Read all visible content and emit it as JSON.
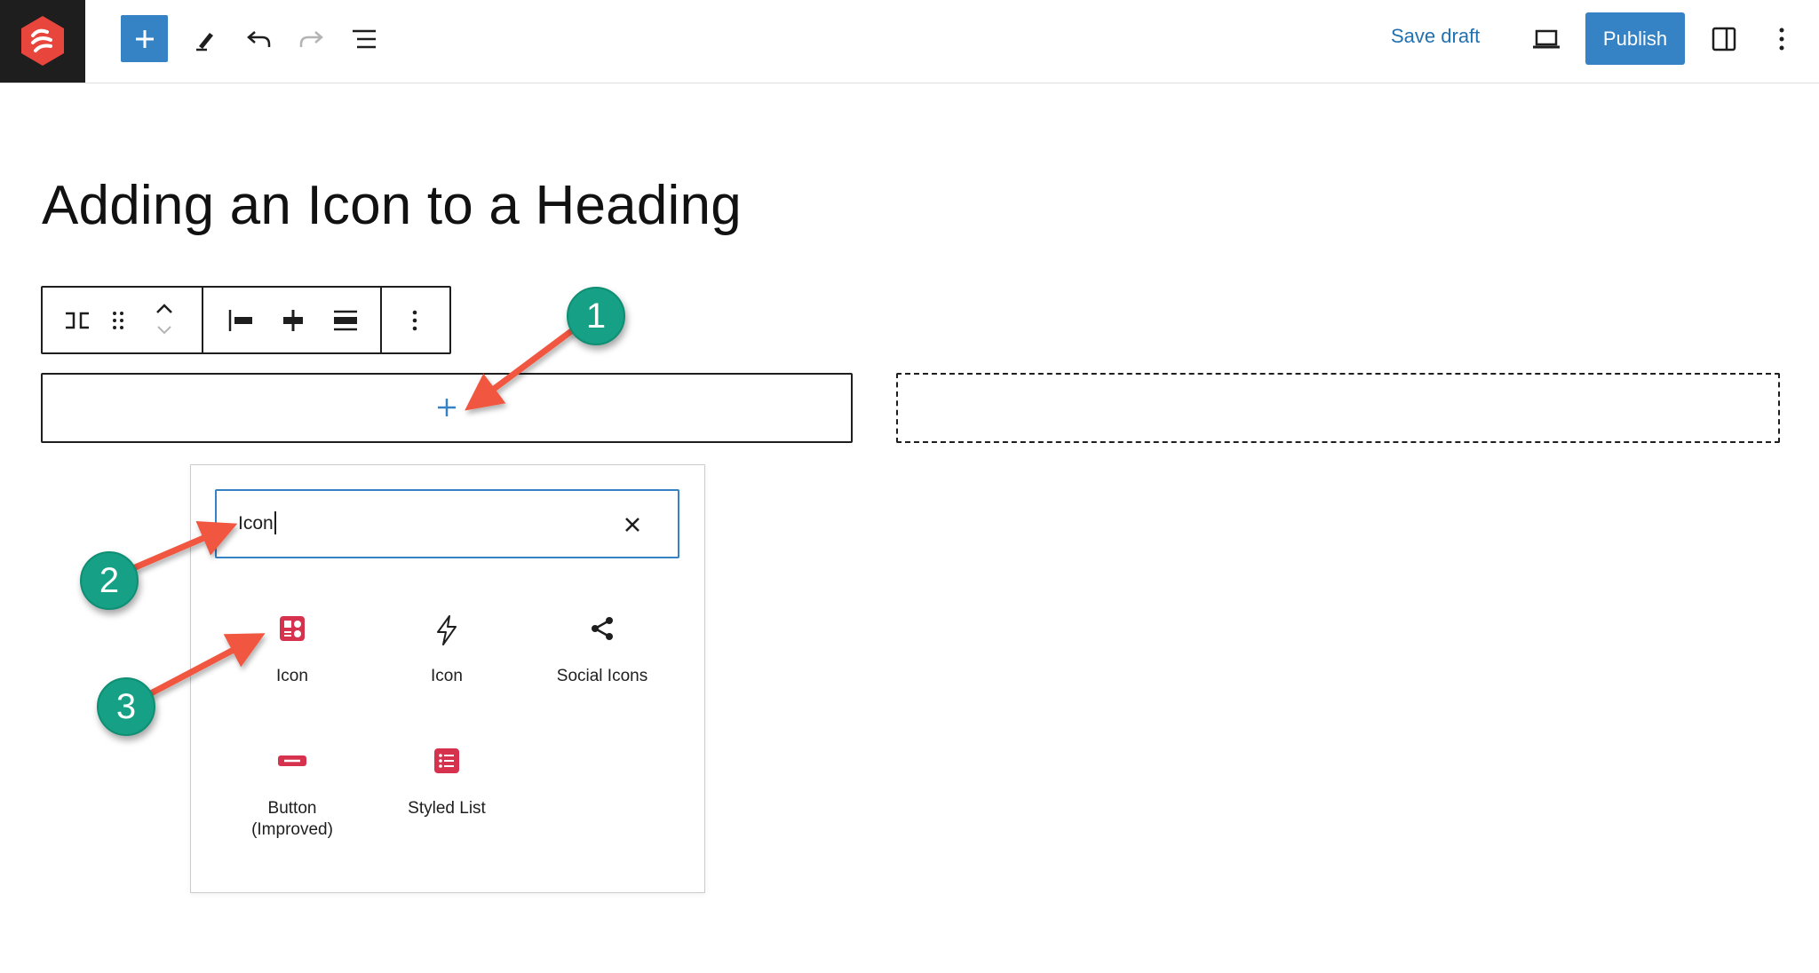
{
  "colors": {
    "accent": "#3582c4",
    "link": "#2271b1",
    "brand": "#e8453c",
    "block_icon": "#d6324e",
    "callout": "#16a085",
    "arrow": "#f0573f"
  },
  "header": {
    "logo_icon": "site-logo-icon",
    "inserter_icon": "plus-icon",
    "tools_icon": "pencil-icon",
    "undo_icon": "undo-icon",
    "redo_icon": "redo-icon",
    "outline_icon": "list-view-icon",
    "save_draft_label": "Save draft",
    "preview_icon": "laptop-icon",
    "publish_label": "Publish",
    "settings_icon": "sidebar-toggle-icon",
    "options_icon": "kebab-icon"
  },
  "editor": {
    "post_title": "Adding an Icon to a Heading",
    "block_toolbar": {
      "buttons": [
        "columns-icon",
        "drag-handle-icon",
        "move-up-down-icon",
        "justify-left-icon",
        "justify-center-icon",
        "justify-stretch-icon",
        "more-options-icon"
      ]
    }
  },
  "inserter": {
    "search_value": "Icon",
    "clear_icon": "close-icon",
    "results": [
      {
        "label": "Icon",
        "icon": "icon-block-icon"
      },
      {
        "label": "Icon",
        "icon": "lightning-icon"
      },
      {
        "label": "Social Icons",
        "icon": "share-icon"
      },
      {
        "label": "Button (Improved)",
        "label_lines": [
          "Button",
          "(Improved)"
        ],
        "icon": "button-block-icon"
      },
      {
        "label": "Styled List",
        "icon": "styled-list-icon"
      }
    ]
  },
  "callouts": [
    {
      "number": "1"
    },
    {
      "number": "2"
    },
    {
      "number": "3"
    }
  ]
}
